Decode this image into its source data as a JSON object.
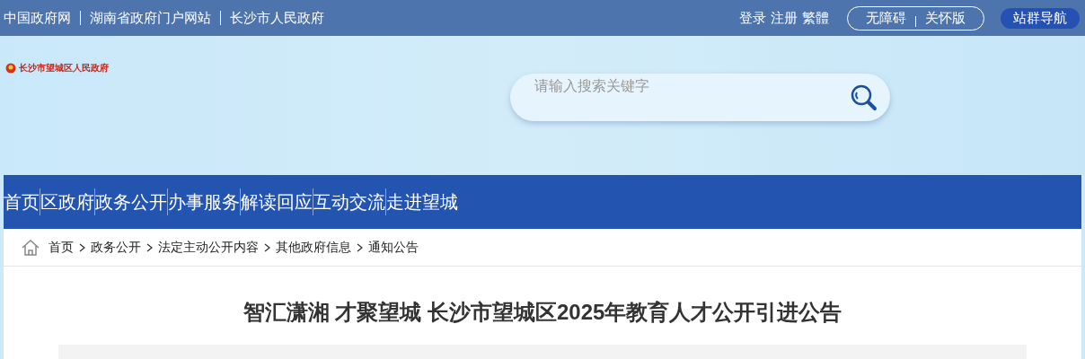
{
  "top_bar": {
    "links": [
      "中国政府网",
      "湖南省政府门户网站",
      "长沙市人民政府"
    ],
    "account_links": [
      "登录",
      "注册",
      "繁體"
    ],
    "mode_buttons": [
      "无障碍",
      "关怀版"
    ],
    "site_nav_button": "站群导航"
  },
  "header": {
    "logo_text": "长沙市望城区人民政府",
    "search": {
      "placeholder": "请输入搜索关键字"
    }
  },
  "main_nav": [
    "首页",
    "区政府",
    "政务公开",
    "办事服务",
    "解读回应",
    "互动交流",
    "走进望城"
  ],
  "breadcrumb": [
    "首页",
    "政务公开",
    "法定主动公开内容",
    "其他政府信息",
    "通知公告"
  ],
  "article": {
    "title": "智汇潇湘 才聚望城 长沙市望城区2025年教育人才公开引进公告"
  }
}
